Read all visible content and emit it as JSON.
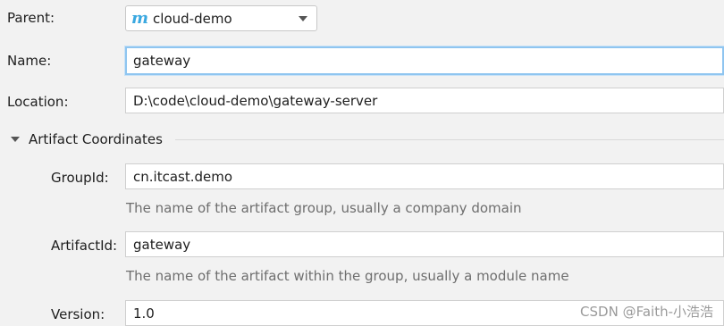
{
  "parent": {
    "label": "Parent:",
    "value": "cloud-demo",
    "icon": "maven-m-icon"
  },
  "name": {
    "label": "Name:",
    "value": "gateway"
  },
  "location": {
    "label": "Location:",
    "value": "D:\\code\\cloud-demo\\gateway-server"
  },
  "artifact_section": {
    "title": "Artifact Coordinates",
    "group_id": {
      "label": "GroupId:",
      "value": "cn.itcast.demo",
      "hint": "The name of the artifact group, usually a company domain"
    },
    "artifact_id": {
      "label": "ArtifactId:",
      "value": "gateway",
      "hint": "The name of the artifact within the group, usually a module name"
    },
    "version": {
      "label": "Version:",
      "value": "1.0"
    }
  },
  "watermark": "CSDN @Faith-小浩浩",
  "colors": {
    "background": "#f2f2f2",
    "focus_border": "#8fc5f0",
    "maven_icon": "#3aa8e0",
    "hint_text": "#6e6e6e"
  }
}
